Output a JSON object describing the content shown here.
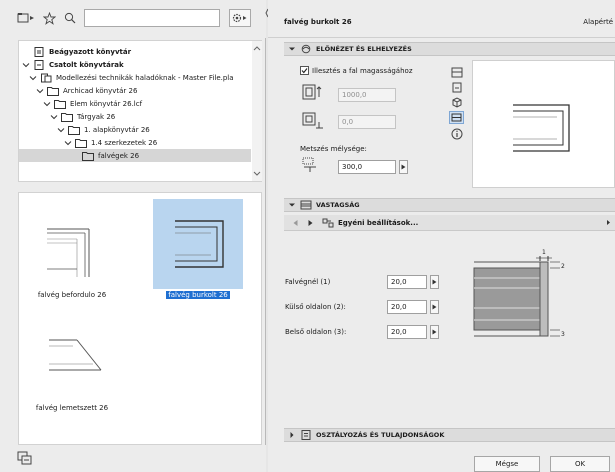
{
  "left": {
    "search": {
      "value": "",
      "placeholder": ""
    },
    "tree": [
      {
        "label": "Beágyazott könyvtár",
        "bold": true,
        "chevron": "none",
        "icon": "embedded-library-icon"
      },
      {
        "label": "Csatolt könyvtárak",
        "bold": true,
        "chevron": "down",
        "icon": "linked-library-icon"
      },
      {
        "label": "Modellezési technikák haladóknak - Master File.pla",
        "bold": false,
        "chevron": "down",
        "icon": "pla-file-icon"
      },
      {
        "label": "Archicad könyvtár 26",
        "bold": false,
        "chevron": "down",
        "icon": "folder-icon"
      },
      {
        "label": "Elem könyvtár 26.lcf",
        "bold": false,
        "chevron": "down",
        "icon": "folder-icon"
      },
      {
        "label": "Tárgyak 26",
        "bold": false,
        "chevron": "down",
        "icon": "folder-icon"
      },
      {
        "label": "1. alapkönyvtár 26",
        "bold": false,
        "chevron": "down",
        "icon": "folder-icon"
      },
      {
        "label": "1.4 szerkezetek 26",
        "bold": false,
        "chevron": "down",
        "icon": "folder-icon"
      },
      {
        "label": "falvégek 26",
        "bold": false,
        "chevron": "none",
        "icon": "folder-icon",
        "selected": true
      }
    ],
    "thumbnails": [
      {
        "caption": "falvég befordulo 26",
        "selected": false
      },
      {
        "caption": "falvég burkolt 26",
        "selected": true
      },
      {
        "caption": "falvég lemetszett 26",
        "selected": false
      }
    ]
  },
  "right": {
    "object_name": "falvég burkolt 26",
    "default_label": "Alapérté",
    "preview": {
      "title": "ELŐNÉZET ÉS ELHELYEZÉS",
      "checkbox_label": "Illesztés a fal magasságához",
      "checkbox_checked": true,
      "height_value": "1000,0",
      "elevation_value": "0,0",
      "cut_depth_label": "Metszés mélysége:",
      "cut_depth_value": "300,0"
    },
    "thickness": {
      "title": "VASTAGSÁG",
      "nav_label": "Egyéni beállítások...",
      "fields": [
        {
          "label": "Falvégnél (1)",
          "value": "20,0"
        },
        {
          "label": "Külső oldalon (2):",
          "value": "20,0"
        },
        {
          "label": "Belső oldalon (3):",
          "value": "20,0"
        }
      ],
      "diagram_labels": [
        "1",
        "2",
        "3"
      ]
    },
    "classification": {
      "title": "OSZTÁLYOZÁS ÉS TULAJDONSÁGOK"
    },
    "buttons": {
      "cancel": "Mégse",
      "ok": "OK"
    }
  }
}
